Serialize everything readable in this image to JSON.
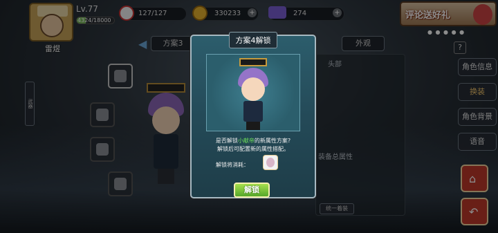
{
  "player": {
    "name": "雷煜",
    "level": "Lv.77",
    "exp_text": "4324/18000",
    "exp_fraction": 0.24
  },
  "resources": [
    {
      "icon": "stamina-icon",
      "value": "127/127"
    },
    {
      "icon": "coin-icon",
      "value": "330233"
    },
    {
      "icon": "gem-icon",
      "value": "274"
    }
  ],
  "promo": {
    "label": "评论送好礼"
  },
  "tabs": {
    "prev_scheme": "方案3",
    "appearance": "外观"
  },
  "panel": {
    "head_label": "头部",
    "equip_total_label": "装备总属性",
    "wear_all": "统一着装"
  },
  "side_menu": [
    {
      "label": "角色信息",
      "active": false
    },
    {
      "label": "换装",
      "active": true
    },
    {
      "label": "角色背景",
      "active": false
    },
    {
      "label": "语音",
      "active": false
    }
  ],
  "side_help": "?",
  "left_vertical_tab": "武器",
  "modal": {
    "title": "方案4解锁",
    "message_prefix": "是否解锁",
    "message_highlight": "小献帝",
    "message_suffix": "的新属性方案?",
    "message_line2": "解锁后可配置新的属性搭配。",
    "cost_label": "解锁将消耗：",
    "unlock_button": "解锁"
  },
  "colors": {
    "accent_green": "#6ee05a",
    "active_tab": "#f3c56c",
    "modal_bg": "#2c5d6c"
  }
}
